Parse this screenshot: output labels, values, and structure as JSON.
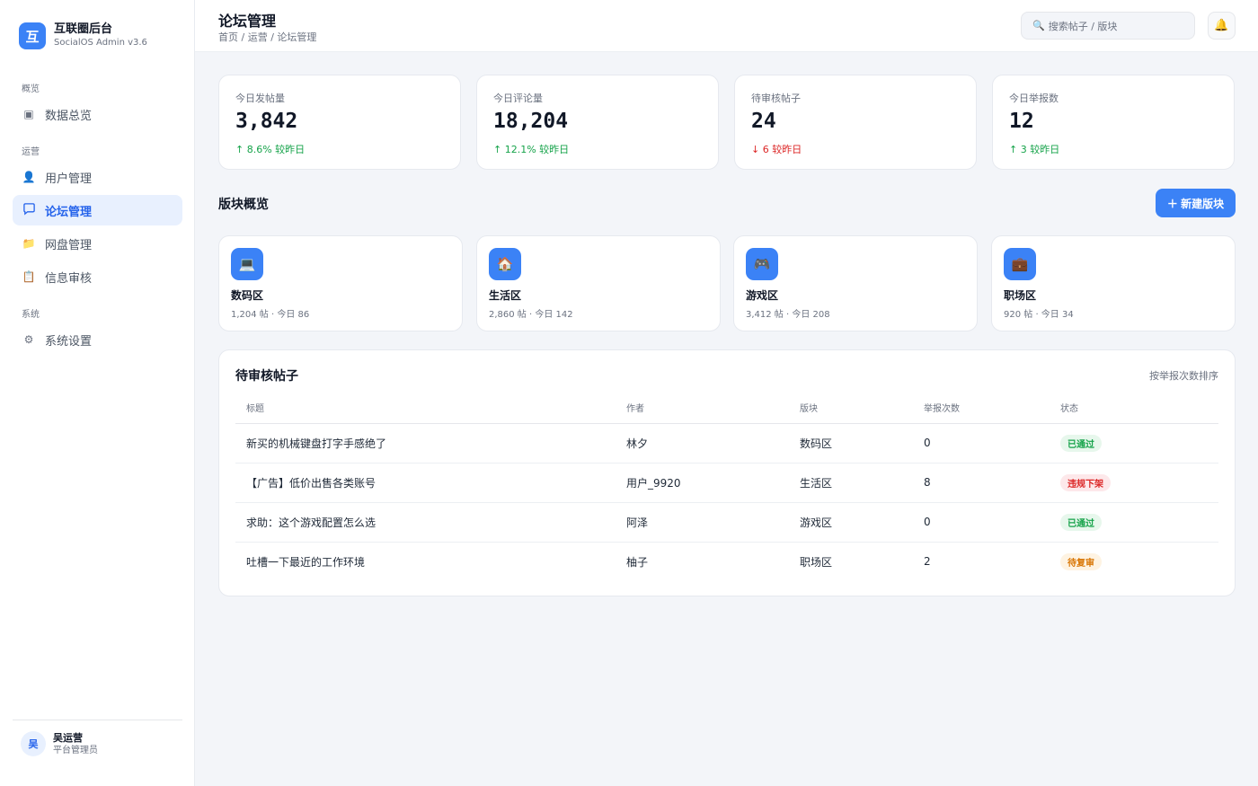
{
  "brand": {
    "logo_char": "互",
    "title": "互联圈后台",
    "subtitle": "SocialOS Admin v3.6"
  },
  "sidebar": {
    "sections": [
      "概览",
      "运营",
      "系统"
    ],
    "items": [
      {
        "icon": "dashboard-icon",
        "glyph": "▣",
        "label": "数据总览"
      },
      {
        "icon": "user-icon",
        "glyph": "👤",
        "label": "用户管理"
      },
      {
        "icon": "chat-bubble-icon",
        "glyph": "💬",
        "label": "论坛管理"
      },
      {
        "icon": "folder-icon",
        "glyph": "📁",
        "label": "网盘管理"
      },
      {
        "icon": "clipboard-icon",
        "glyph": "📋",
        "label": "信息审核"
      },
      {
        "icon": "gear-icon",
        "glyph": "⚙",
        "label": "系统设置"
      }
    ]
  },
  "user": {
    "avatar_char": "吴",
    "name": "吴运营",
    "role": "平台管理员"
  },
  "header": {
    "title": "论坛管理",
    "breadcrumb": "首页 / 运营 / 论坛管理",
    "search_placeholder": "搜索帖子 / 版块"
  },
  "stats": [
    {
      "label": "今日发帖量",
      "value": "3,842",
      "change": "↑ 8.6% 较昨日",
      "trend": "up"
    },
    {
      "label": "今日评论量",
      "value": "18,204",
      "change": "↑ 12.1% 较昨日",
      "trend": "up"
    },
    {
      "label": "待审核帖子",
      "value": "24",
      "change": "↓ 6 较昨日",
      "trend": "down"
    },
    {
      "label": "今日举报数",
      "value": "12",
      "change": "↑ 3 较昨日",
      "trend": "up"
    }
  ],
  "boards_section": {
    "title": "版块概览",
    "new_button": "＋ 新建版块"
  },
  "boards": [
    {
      "icon": "laptop-icon",
      "glyph": "💻",
      "name": "数码区",
      "meta": "1,204 帖 · 今日 86"
    },
    {
      "icon": "house-icon",
      "glyph": "🏠",
      "name": "生活区",
      "meta": "2,860 帖 · 今日 142"
    },
    {
      "icon": "gamepad-icon",
      "glyph": "🎮",
      "name": "游戏区",
      "meta": "3,412 帖 · 今日 208"
    },
    {
      "icon": "briefcase-icon",
      "glyph": "💼",
      "name": "职场区",
      "meta": "920 帖 · 今日 34"
    }
  ],
  "pending": {
    "title": "待审核帖子",
    "sort_label": "按举报次数排序",
    "columns": [
      "标题",
      "作者",
      "版块",
      "举报次数",
      "状态"
    ],
    "rows": [
      {
        "title": "新买的机械键盘打字手感绝了",
        "author": "林夕",
        "board": "数码区",
        "reports": "0",
        "status": "已通过",
        "status_type": "ok"
      },
      {
        "title": "【广告】低价出售各类账号",
        "author": "用户_9920",
        "board": "生活区",
        "reports": "8",
        "status": "违规下架",
        "status_type": "ban"
      },
      {
        "title": "求助：这个游戏配置怎么选",
        "author": "阿泽",
        "board": "游戏区",
        "reports": "0",
        "status": "已通过",
        "status_type": "ok"
      },
      {
        "title": "吐槽一下最近的工作环境",
        "author": "柚子",
        "board": "职场区",
        "reports": "2",
        "status": "待复审",
        "status_type": "wait"
      }
    ]
  },
  "colors": {
    "accent": "#3b82f6",
    "active_bg": "#e8f0fe",
    "up": "#16a34a",
    "down": "#dc2626"
  }
}
